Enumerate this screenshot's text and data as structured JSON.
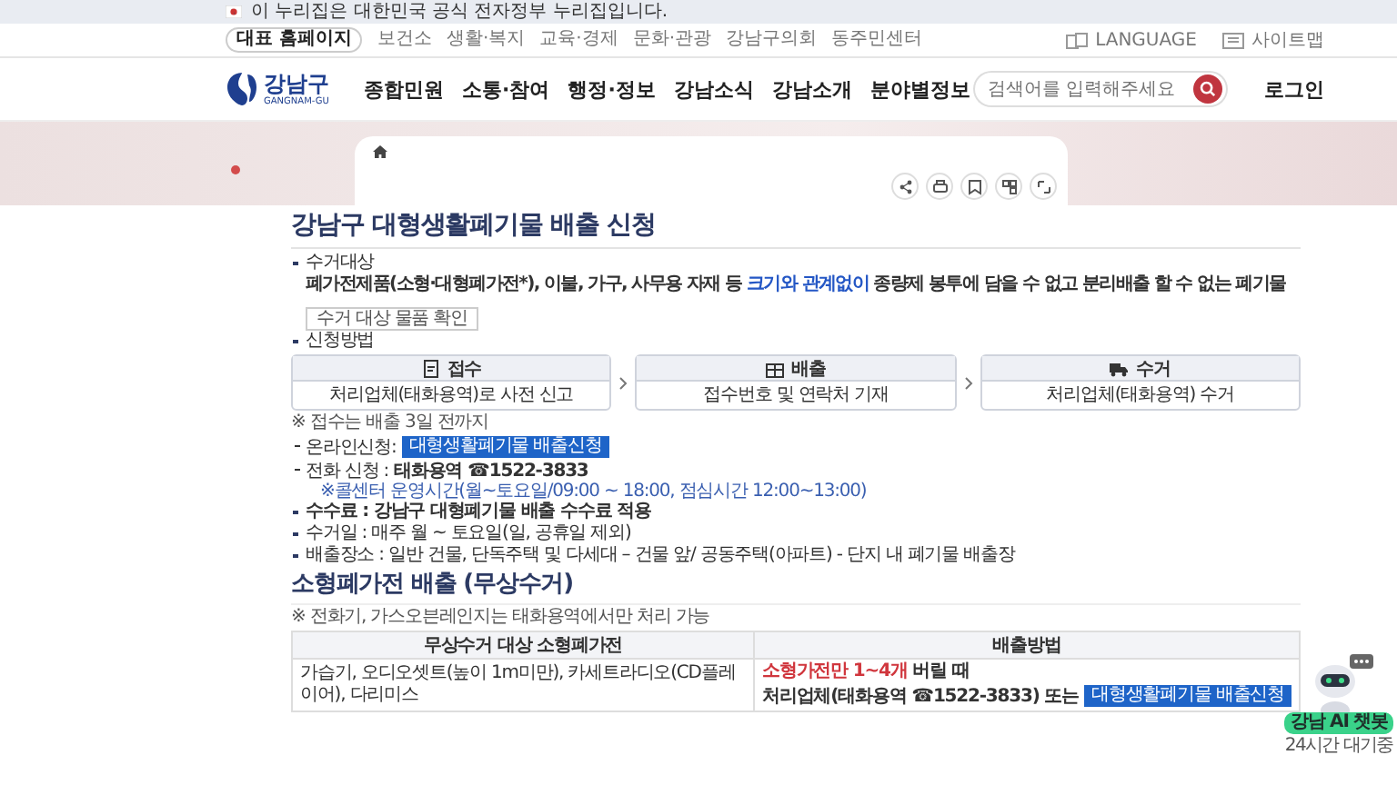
{
  "notice": {
    "text": "이 누리집은 대한민국 공식 전자정부 누리집입니다."
  },
  "utility_links": [
    {
      "label": "대표 홈페이지",
      "selected": true
    },
    {
      "label": "보건소",
      "selected": false
    },
    {
      "label": "생활·복지",
      "selected": false
    },
    {
      "label": "교육·경제",
      "selected": false
    },
    {
      "label": "문화·관광",
      "selected": false
    },
    {
      "label": "강남구의회",
      "selected": false
    },
    {
      "label": "동주민센터",
      "selected": false
    }
  ],
  "utility_right": [
    {
      "label": "LANGUAGE",
      "kind": "language"
    },
    {
      "label": "사이트맵",
      "kind": "sitemap"
    }
  ],
  "logo": {
    "name": "강남구",
    "subtitle": "GANGNAM-GU"
  },
  "nav": [
    "종합민원",
    "소통·참여",
    "행정·정보",
    "강남소식",
    "강남소개",
    "분야별정보"
  ],
  "search": {
    "placeholder": "검색어를 입력해주세요"
  },
  "login": "로그인",
  "page": {
    "title": "강남구 대형생활폐기물 배출 신청",
    "collection_target": {
      "label": "수거대상",
      "description": [
        {
          "text": "폐가전제품(소형·대형폐가전*), 이불, 가구, 사무용 자재 등 ",
          "kind": "bold"
        },
        {
          "text": "크기와 관계없이",
          "kind": "link"
        },
        {
          "text": " 종량제 봉투에 담을 수 없고 분리배출 할 수 없는 폐기물",
          "kind": "bold"
        }
      ],
      "button": "수거 대상 물품 확인"
    },
    "application": {
      "label": "신청방법",
      "steps": [
        {
          "kind": "form",
          "title": "접수",
          "text": "처리업체(태화용역)로 사전 신고"
        },
        {
          "kind": "box",
          "title": "배출",
          "text": "접수번호 및 연락처 기재"
        },
        {
          "kind": "truck",
          "title": "수거",
          "text": "처리업체(태화용역) 수거"
        }
      ],
      "note": "※ 접수는 배출 3일 전까지",
      "online": {
        "label": "온라인신청:",
        "button": "대형생활폐기물 배출신청"
      },
      "phone": {
        "label": "전화 신청 :",
        "value": "태화용역 ☎1522-3833",
        "note": "※콜센터 운영시간(월~토요일/09:00 ~ 18:00, 점심시간 12:00~13:00)"
      }
    },
    "details": [
      {
        "text": "수수료 : 강남구 대형폐기물 배출 수수료 적용",
        "bold": true
      },
      {
        "text": "수거일 : 매주 월 ~ 토요일(일, 공휴일 제외)",
        "bold": false
      },
      {
        "text": "배출장소 : 일반 건물, 단독주택 및 다세대 – 건물 앞/ 공동주택(아파트) - 단지 내 폐기물 배출장",
        "bold": false
      }
    ]
  },
  "small_appliances": {
    "title": "소형폐가전 배출 (무상수거)",
    "note": "※ 전화기, 가스오븐레인지는 태화용역에서만 처리 가능",
    "table": {
      "columns": [
        "무상수거 대상 소형폐가전",
        "배출방법"
      ],
      "rows": [
        {
          "items": "가습기, 오디오셋트(높이 1m미만), 카세트라디오(CD플레이어), 다리미스",
          "condition": [
            {
              "text": "소형가전만 1~4개",
              "kind": "highlight"
            },
            {
              "text": " 버릴 때",
              "kind": "bold"
            }
          ],
          "contact": "처리업체(태화용역 ☎1522-3833) 또는",
          "button": "대형생활폐기물 배출신청"
        }
      ]
    }
  },
  "chatbot": {
    "label": "강남 AI 챗봇",
    "status": "24시간 대기중"
  }
}
